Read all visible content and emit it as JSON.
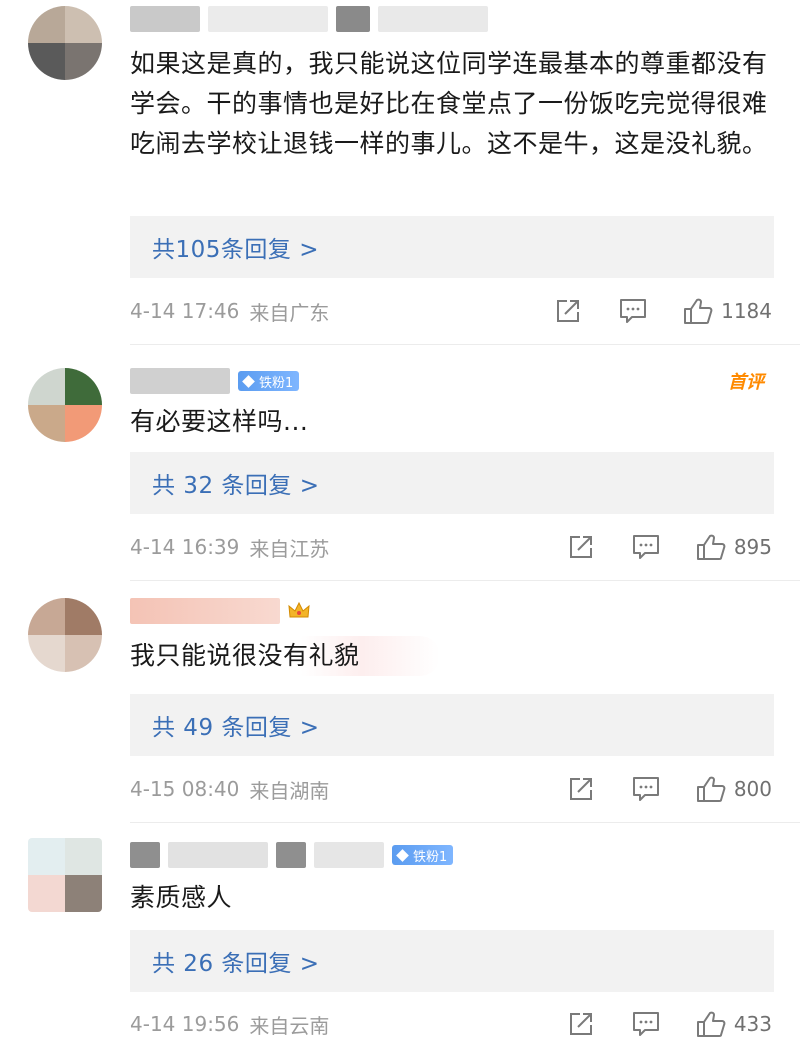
{
  "comments": [
    {
      "text": "如果这是真的，我只能说这位同学连最基本的尊重都没有学会。干的事情也是好比在食堂点了一份饭吃完觉得很难吃闹去学校让退钱一样的事儿。这不是牛，这是没礼貌。",
      "replies": "共105条回复 >",
      "time": "4-14 17:46",
      "location": "来自广东",
      "likes": "1184"
    },
    {
      "badge": "铁粉1",
      "tag": "首评",
      "text": "有必要这样吗...",
      "replies": "共 32 条回复 >",
      "time": "4-14 16:39",
      "location": "来自江苏",
      "likes": "895"
    },
    {
      "text": "我只能说很没有礼貌",
      "replies": "共 49 条回复 >",
      "time": "4-15 08:40",
      "location": "来自湖南",
      "likes": "800"
    },
    {
      "badge": "铁粉1",
      "text": "素质感人",
      "replies": "共 26 条回复 >",
      "time": "4-14 19:56",
      "location": "来自云南",
      "likes": "433"
    }
  ],
  "icons": {
    "share": "share-icon",
    "comment": "comment-icon",
    "like": "like-icon",
    "crown": "crown-icon"
  },
  "colors": {
    "reply_link": "#3b6fb6",
    "meta_text": "#9b9b9b",
    "badge": "#5b9cf0",
    "first_comment_tag": "#ff8a00"
  }
}
